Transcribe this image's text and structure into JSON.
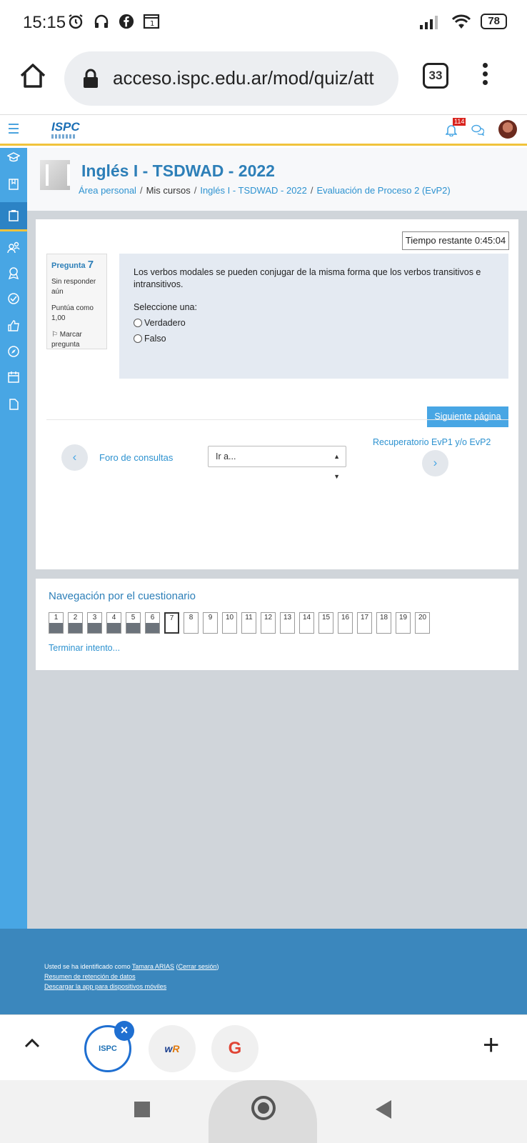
{
  "status_bar": {
    "time": "15:15",
    "battery": "78"
  },
  "browser": {
    "url": "acceso.ispc.edu.ar/mod/quiz/att",
    "tab_count": "33"
  },
  "navbar": {
    "logo_text": "ISPC",
    "notification_count": "114"
  },
  "course": {
    "title": "Inglés I - TSDWAD - 2022",
    "breadcrumb": [
      "Área personal",
      "Mis cursos",
      "Inglés I - TSDWAD - 2022",
      "Evaluación de Proceso 2 (EvP2)"
    ]
  },
  "quiz": {
    "timer": "Tiempo restante 0:45:04",
    "question_label": "Pregunta",
    "question_number": "7",
    "state": "Sin responder aún",
    "score": "Puntúa como 1,00",
    "flag": "Marcar pregunta",
    "question_text": "Los verbos modales se pueden conjugar de la misma forma que los verbos transitivos e intransitivos.",
    "select_one": "Seleccione una:",
    "options": [
      "Verdadero",
      "Falso"
    ],
    "next_page": "Siguiente página",
    "prev_activity": "Foro de consultas",
    "jump_placeholder": "Ir a...",
    "next_activity": "Recuperatorio EvP1 y/o EvP2",
    "prev_arrow": "‹",
    "next_arrow": "›"
  },
  "navigation": {
    "title": "Navegación por el cuestionario",
    "buttons": [
      "1",
      "2",
      "3",
      "4",
      "5",
      "6",
      "7",
      "8",
      "9",
      "10",
      "11",
      "12",
      "13",
      "14",
      "15",
      "16",
      "17",
      "18",
      "19",
      "20"
    ],
    "answered_count": 6,
    "current": "7",
    "finish": "Terminar intento..."
  },
  "footer": {
    "logged_prefix": "Usted se ha identificado como",
    "user": "Tamara ARIAS",
    "logout": "Cerrar sesión",
    "retention": "Resumen de retención de datos",
    "app": "Descargar la app para dispositivos móviles"
  },
  "tabstrip": {
    "ispc_label": "ISPC",
    "wr_w": "w",
    "wr_r": "R",
    "google": "G",
    "plus": "+"
  },
  "colors": {
    "accent": "#48a6e4",
    "link": "#2d92d0",
    "footer": "#3b87bd",
    "highlight": "#f0c33c"
  }
}
